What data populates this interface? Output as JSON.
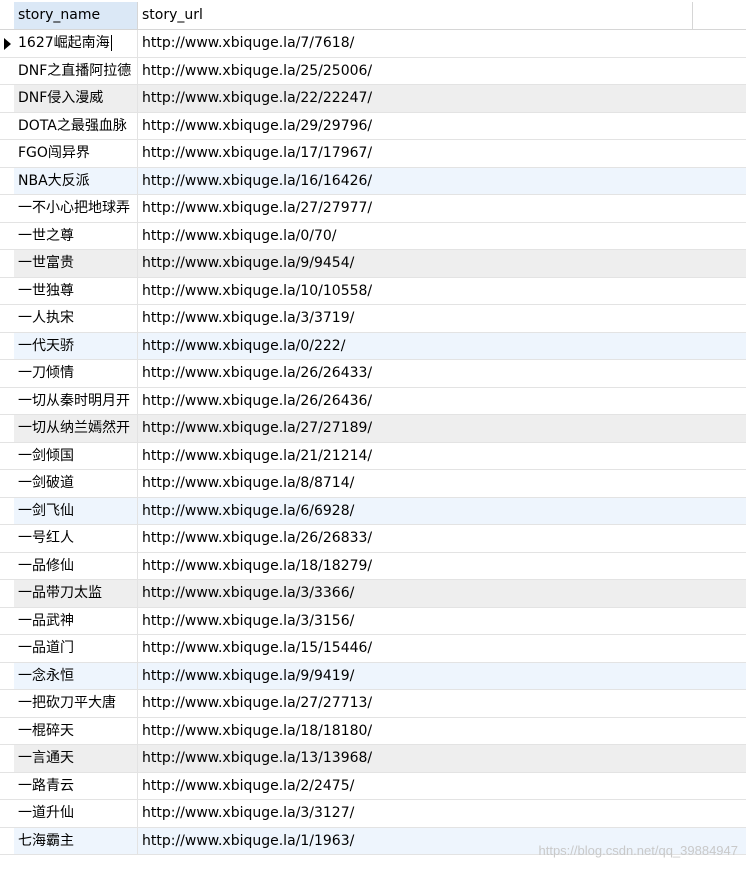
{
  "grid": {
    "columns": [
      "story_name",
      "story_url"
    ],
    "rows": [
      {
        "name": "1627崛起南海",
        "url": "http://www.xbiquge.la/7/7618/",
        "shade": "white",
        "current": true
      },
      {
        "name": "DNF之直播阿拉德",
        "url": "http://www.xbiquge.la/25/25006/",
        "shade": "white"
      },
      {
        "name": "DNF侵入漫威",
        "url": "http://www.xbiquge.la/22/22247/",
        "shade": "gray"
      },
      {
        "name": "DOTA之最强血脉",
        "url": "http://www.xbiquge.la/29/29796/",
        "shade": "white"
      },
      {
        "name": "FGO闯异界",
        "url": "http://www.xbiquge.la/17/17967/",
        "shade": "white"
      },
      {
        "name": "NBA大反派",
        "url": "http://www.xbiquge.la/16/16426/",
        "shade": "blue"
      },
      {
        "name": "一不小心把地球弄",
        "url": "http://www.xbiquge.la/27/27977/",
        "shade": "white"
      },
      {
        "name": "一世之尊",
        "url": "http://www.xbiquge.la/0/70/",
        "shade": "white"
      },
      {
        "name": "一世富贵",
        "url": "http://www.xbiquge.la/9/9454/",
        "shade": "gray"
      },
      {
        "name": "一世独尊",
        "url": "http://www.xbiquge.la/10/10558/",
        "shade": "white"
      },
      {
        "name": "一人执宋",
        "url": "http://www.xbiquge.la/3/3719/",
        "shade": "white"
      },
      {
        "name": "一代天骄",
        "url": "http://www.xbiquge.la/0/222/",
        "shade": "blue"
      },
      {
        "name": "一刀倾情",
        "url": "http://www.xbiquge.la/26/26433/",
        "shade": "white"
      },
      {
        "name": "一切从秦时明月开",
        "url": "http://www.xbiquge.la/26/26436/",
        "shade": "white"
      },
      {
        "name": "一切从纳兰嫣然开",
        "url": "http://www.xbiquge.la/27/27189/",
        "shade": "gray"
      },
      {
        "name": "一剑倾国",
        "url": "http://www.xbiquge.la/21/21214/",
        "shade": "white"
      },
      {
        "name": "一剑破道",
        "url": "http://www.xbiquge.la/8/8714/",
        "shade": "white"
      },
      {
        "name": "一剑飞仙",
        "url": "http://www.xbiquge.la/6/6928/",
        "shade": "blue"
      },
      {
        "name": "一号红人",
        "url": "http://www.xbiquge.la/26/26833/",
        "shade": "white"
      },
      {
        "name": "一品修仙",
        "url": "http://www.xbiquge.la/18/18279/",
        "shade": "white"
      },
      {
        "name": "一品带刀太监",
        "url": "http://www.xbiquge.la/3/3366/",
        "shade": "gray"
      },
      {
        "name": "一品武神",
        "url": "http://www.xbiquge.la/3/3156/",
        "shade": "white"
      },
      {
        "name": "一品道门",
        "url": "http://www.xbiquge.la/15/15446/",
        "shade": "white"
      },
      {
        "name": "一念永恒",
        "url": "http://www.xbiquge.la/9/9419/",
        "shade": "blue"
      },
      {
        "name": "一把砍刀平大唐",
        "url": "http://www.xbiquge.la/27/27713/",
        "shade": "white"
      },
      {
        "name": "一棍碎天",
        "url": "http://www.xbiquge.la/18/18180/",
        "shade": "white"
      },
      {
        "name": "一言通天",
        "url": "http://www.xbiquge.la/13/13968/",
        "shade": "gray"
      },
      {
        "name": "一路青云",
        "url": "http://www.xbiquge.la/2/2475/",
        "shade": "white"
      },
      {
        "name": "一道升仙",
        "url": "http://www.xbiquge.la/3/3127/",
        "shade": "white"
      },
      {
        "name": "七海霸主",
        "url": "http://www.xbiquge.la/1/1963/",
        "shade": "blue"
      }
    ]
  },
  "watermark": "https://blog.csdn.net/qq_39884947",
  "colors": {
    "header_selected": "#dbe8f6",
    "row_gray": "#eeeeee",
    "row_blue": "#eef5fd",
    "grid_line": "#e3e3e3"
  },
  "icons": {
    "current_row": "triangle-right-icon"
  }
}
